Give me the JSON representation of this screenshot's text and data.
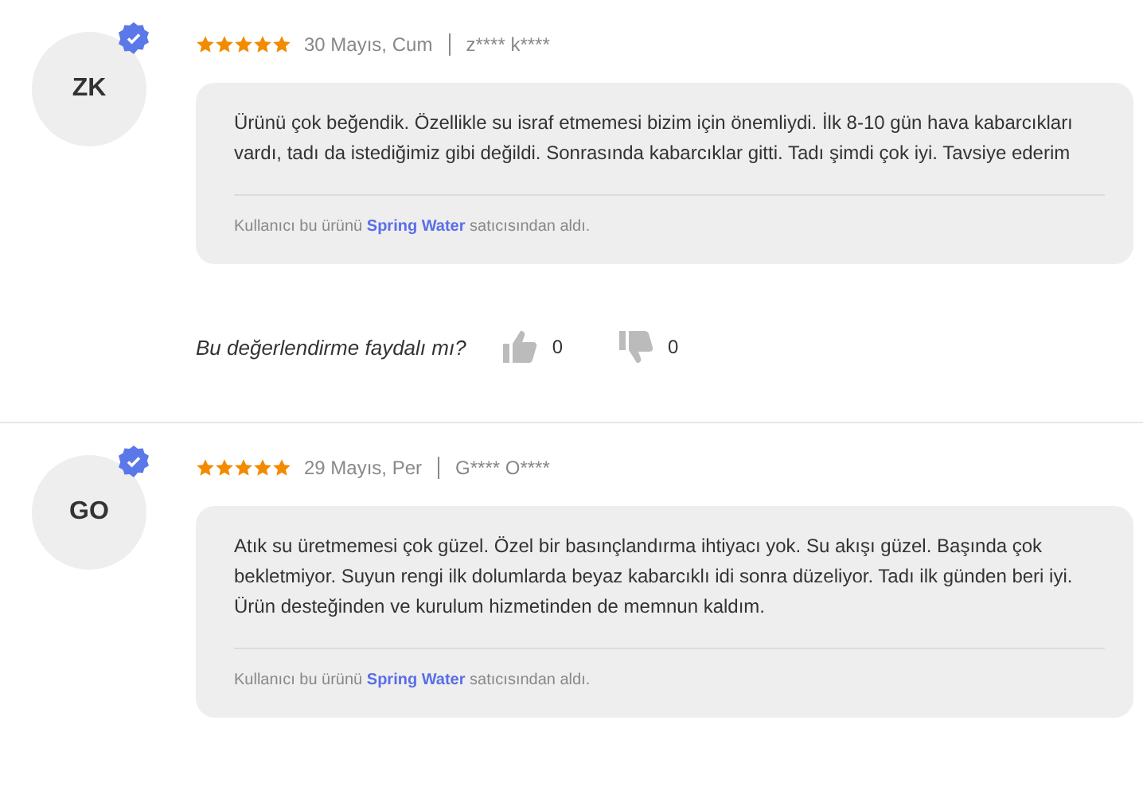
{
  "reviews": [
    {
      "initials": "ZK",
      "verified": true,
      "stars": 5,
      "date": "30 Mayıs, Cum",
      "author": "z**** k****",
      "text": "Ürünü çok beğendik. Özellikle su israf etmemesi bizim için önemliydi. İlk 8-10 gün hava kabarcıkları vardı, tadı da istediğimiz gibi değildi. Sonrasında kabarcıklar gitti. Tadı şimdi çok iyi. Tavsiye ederim",
      "seller_prefix": "Kullanıcı bu ürünü",
      "seller": "Spring Water",
      "seller_suffix": "satıcısından aldı.",
      "helpful": {
        "question": "Bu değerlendirme faydalı mı?",
        "likes": "0",
        "dislikes": "0"
      }
    },
    {
      "initials": "GO",
      "verified": true,
      "stars": 5,
      "date": "29 Mayıs, Per",
      "author": "G**** O****",
      "text": "Atık su üretmemesi çok güzel. Özel bir basınçlandırma ihtiyacı yok. Su akışı güzel. Başında çok bekletmiyor. Suyun rengi ilk dolumlarda beyaz kabarcıklı idi sonra düzeliyor. Tadı ilk günden beri iyi. Ürün desteğinden ve kurulum hizmetinden de memnun kaldım.",
      "seller_prefix": "Kullanıcı bu ürünü",
      "seller": "Spring Water",
      "seller_suffix": "satıcısından aldı."
    }
  ]
}
